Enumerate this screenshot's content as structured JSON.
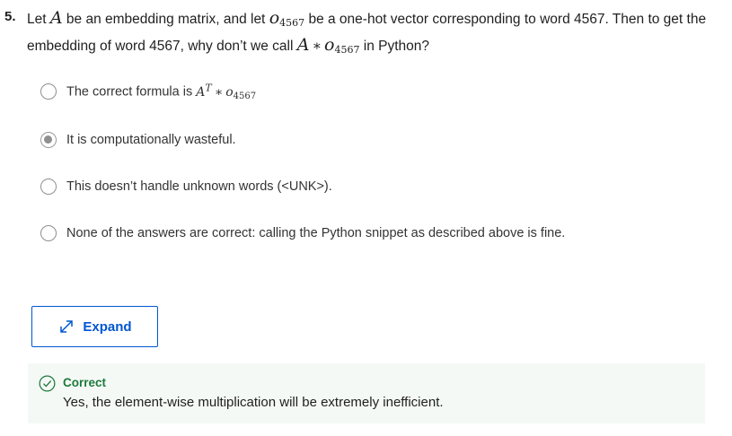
{
  "question": {
    "number": "5.",
    "text_1": "Let",
    "var_A": "A",
    "text_2": "be an embedding matrix, and let",
    "var_o": "o",
    "subscript": "4567",
    "text_3": "be a one-hot vector corresponding to word 4567. Then to get the embedding of word 4567, why don’t we call",
    "operator": "∗",
    "text_4": "in Python?"
  },
  "options": [
    {
      "label": "The correct formula is",
      "math_var": "A",
      "math_sup": "T",
      "math_op": "∗",
      "math_o": "o",
      "math_sub": "4567",
      "selected": false
    },
    {
      "label": "It is computationally wasteful.",
      "selected": true
    },
    {
      "label": "This doesn’t handle unknown words (<UNK>).",
      "selected": false
    },
    {
      "label": "None of the answers are correct: calling the Python snippet as described above is fine.",
      "selected": false
    }
  ],
  "expand_button": {
    "label": "Expand",
    "icon": "expand-arrows-icon"
  },
  "feedback": {
    "status": "Correct",
    "text": "Yes, the element-wise multiplication will be extremely inefficient.",
    "icon": "check-circle-icon",
    "status_color": "#1e7a3c",
    "background": "#f5f9f6"
  },
  "colors": {
    "accent": "#0056d2",
    "radio_selected": "#8f8f8f"
  }
}
